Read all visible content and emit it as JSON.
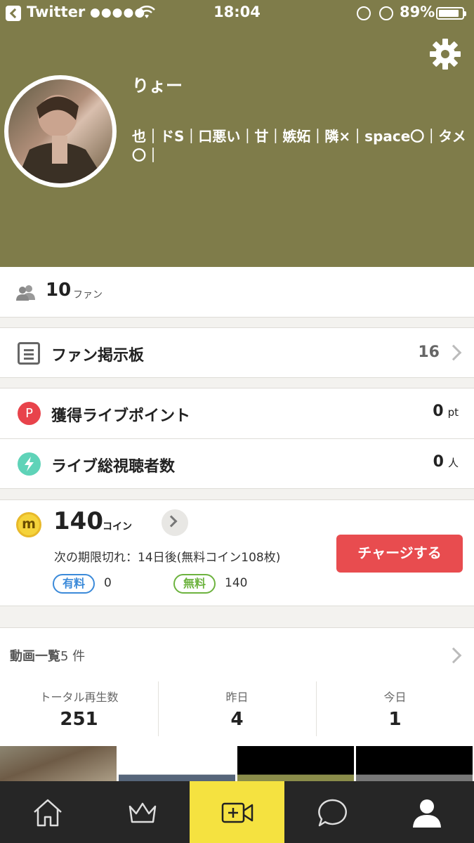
{
  "status_bar": {
    "back_app": "Twitter",
    "signal": "●●●●●",
    "time": "18:04",
    "battery_percent": "89%",
    "battery_level": 0.89,
    "icons": [
      "back-arrow-icon",
      "wifi-icon",
      "rotation-lock-icon",
      "alarm-icon",
      "battery-icon"
    ]
  },
  "profile": {
    "name": "りょー",
    "bio": "也｜ドS｜口悪い｜甘｜嫉妬｜隣×｜space〇｜タメ〇｜",
    "header_color": "#7f7c4a",
    "settings_icon": "gear-icon"
  },
  "fans": {
    "count": "10",
    "unit": "ファン"
  },
  "fan_board": {
    "label": "ファン掲示板",
    "count": "16"
  },
  "live_points": {
    "icon_letter": "P",
    "label": "獲得ライブポイント",
    "value": "0",
    "unit": "pt"
  },
  "live_viewers": {
    "label": "ライブ総視聴者数",
    "value": "0",
    "unit": "人"
  },
  "coins": {
    "icon_letter": "m",
    "amount": "140",
    "unit": "コイン",
    "expiry": "次の期限切れ：14日後(無料コイン108枚)",
    "paid_label": "有料",
    "paid_value": "0",
    "free_label": "無料",
    "free_value": "140",
    "charge_button": "チャージする",
    "accent": "#e84c4f"
  },
  "videos": {
    "title_prefix": "動画一覧",
    "count_text": "5 件",
    "stats": [
      {
        "label": "トータル再生数",
        "value": "251"
      },
      {
        "label": "昨日",
        "value": "4"
      },
      {
        "label": "今日",
        "value": "1"
      }
    ]
  },
  "tab_bar": {
    "tabs": [
      "home-icon",
      "crown-icon",
      "video-add-icon",
      "chat-icon",
      "profile-icon"
    ],
    "active_index": 2,
    "active_color": "#f5e240"
  }
}
